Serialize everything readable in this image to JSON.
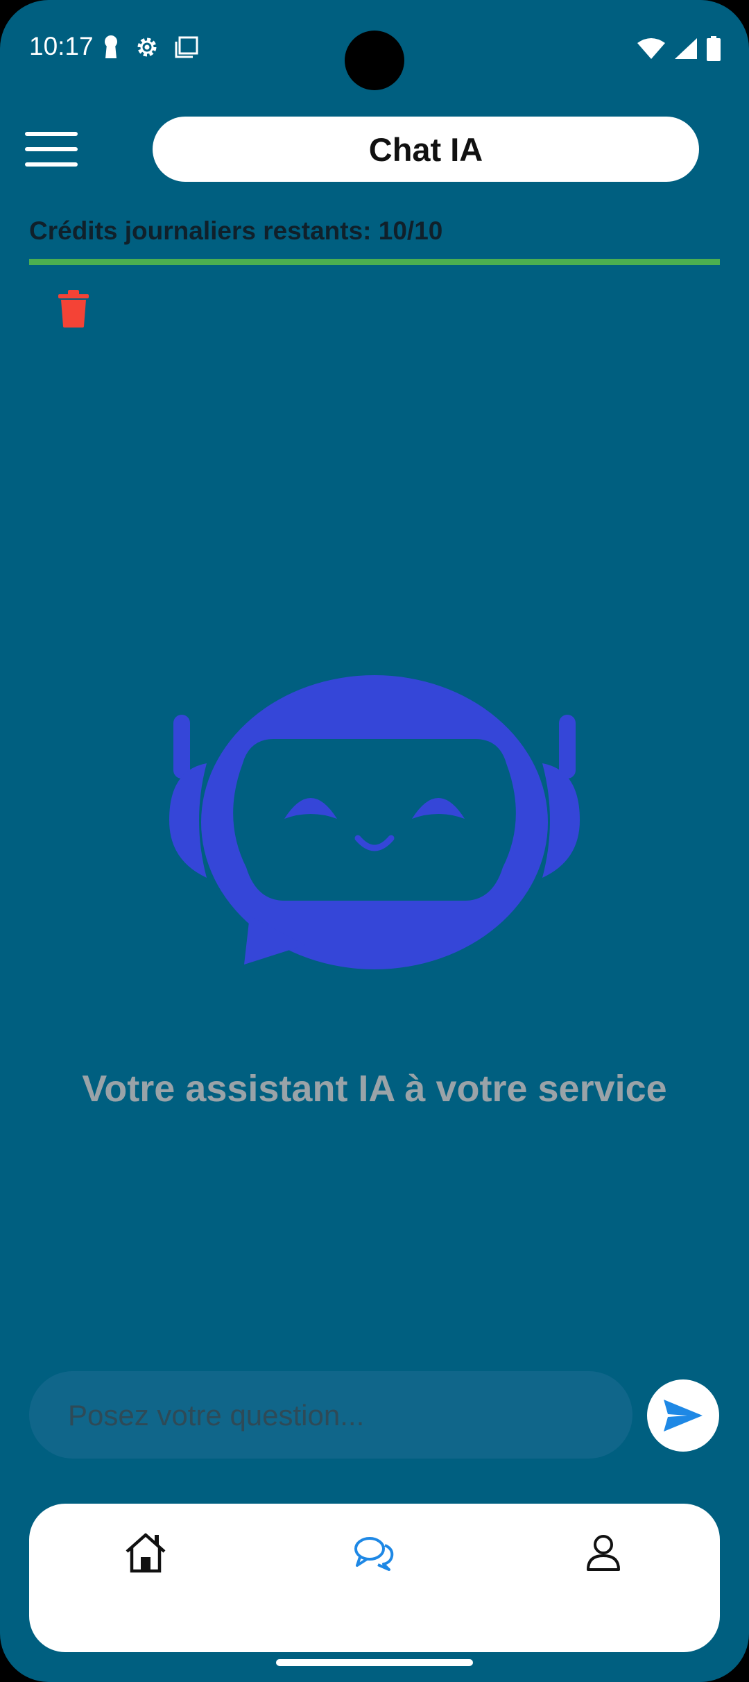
{
  "status_bar": {
    "time": "10:17",
    "left_icons": [
      "keyhole-icon",
      "gear-icon",
      "screenshot-icon"
    ],
    "right_icons": [
      "wifi-icon",
      "signal-icon",
      "battery-icon"
    ]
  },
  "header": {
    "menu_icon": "hamburger-menu-icon",
    "title": "Chat IA"
  },
  "credits": {
    "label": "Crédits journaliers restants: 10/10",
    "remaining": 10,
    "total": 10,
    "bar_color": "#4caf50"
  },
  "actions": {
    "delete_icon": "trash-icon",
    "delete_color": "#f44336"
  },
  "empty_state": {
    "illustration": "robot-chat-icon",
    "robot_color": "#3546d8",
    "message": "Votre assistant IA à votre service"
  },
  "composer": {
    "placeholder": "Posez votre question...",
    "value": "",
    "send_icon": "send-icon",
    "send_color": "#1e88e5"
  },
  "bottom_nav": {
    "items": [
      {
        "icon": "home-icon",
        "active": false
      },
      {
        "icon": "chat-icon",
        "active": true
      },
      {
        "icon": "profile-icon",
        "active": false
      }
    ],
    "active_color": "#1e88e5"
  },
  "colors": {
    "background": "#005f80",
    "surface": "#ffffff"
  }
}
